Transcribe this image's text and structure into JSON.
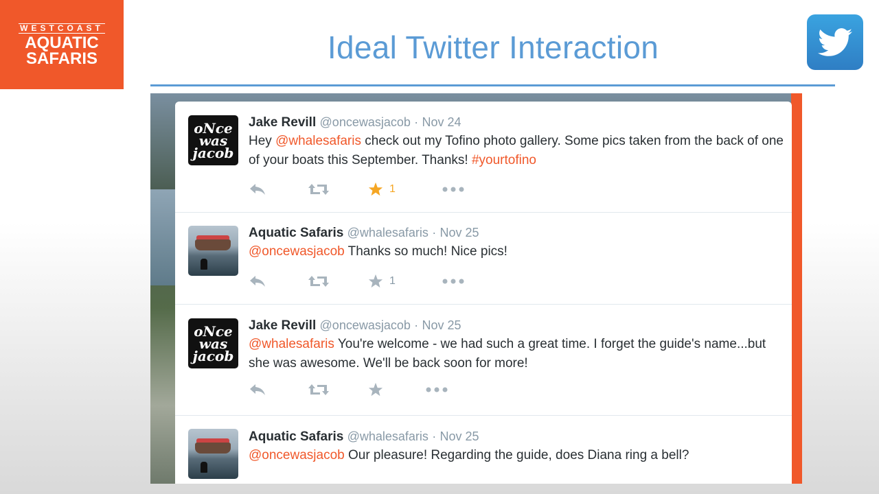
{
  "logo": {
    "line1": "WESTCOAST",
    "line2": "AQUATIC",
    "line3": "SAFARIS"
  },
  "slide": {
    "title": "Ideal Twitter Interaction"
  },
  "colors": {
    "accent": "#5b9bd5",
    "brand_orange": "#f0582a",
    "mention": "#f0582a",
    "favorite": "#f5a623"
  },
  "tweets": [
    {
      "name": "Jake Revill",
      "handle": "@oncewasjacob",
      "sep": "·",
      "date": "Nov 24",
      "parts": [
        "Hey ",
        "@whalesafaris",
        " check out my Tofino photo gallery. Some pics taken from the back of one of your boats this September. Thanks! ",
        "#yourtofino"
      ],
      "fav_count": "1",
      "favorited": true,
      "avatar": "oncewasjacob-logo"
    },
    {
      "name": "Aquatic Safaris",
      "handle": "@whalesafaris",
      "sep": "·",
      "date": "Nov 25",
      "parts": [
        "@oncewasjacob",
        " Thanks so much! Nice pics!"
      ],
      "fav_count": "1",
      "favorited": false,
      "avatar": "whale-boat-photo"
    },
    {
      "name": "Jake Revill",
      "handle": "@oncewasjacob",
      "sep": "·",
      "date": "Nov 25",
      "parts": [
        "@whalesafaris",
        " You're welcome - we had such a great time. I forget the guide's name...but she was awesome. We'll be back soon for more!"
      ],
      "fav_count": "",
      "favorited": false,
      "avatar": "oncewasjacob-logo"
    },
    {
      "name": "Aquatic Safaris",
      "handle": "@whalesafaris",
      "sep": "·",
      "date": "Nov 25",
      "parts": [
        "@oncewasjacob",
        " Our pleasure! Regarding the guide, does Diana ring a bell?"
      ],
      "avatar": "whale-boat-photo"
    }
  ],
  "icons": {
    "reply": "reply-icon",
    "retweet": "retweet-icon",
    "favorite": "star-icon",
    "more": "more-icon",
    "brand": "twitter-bird-icon"
  }
}
